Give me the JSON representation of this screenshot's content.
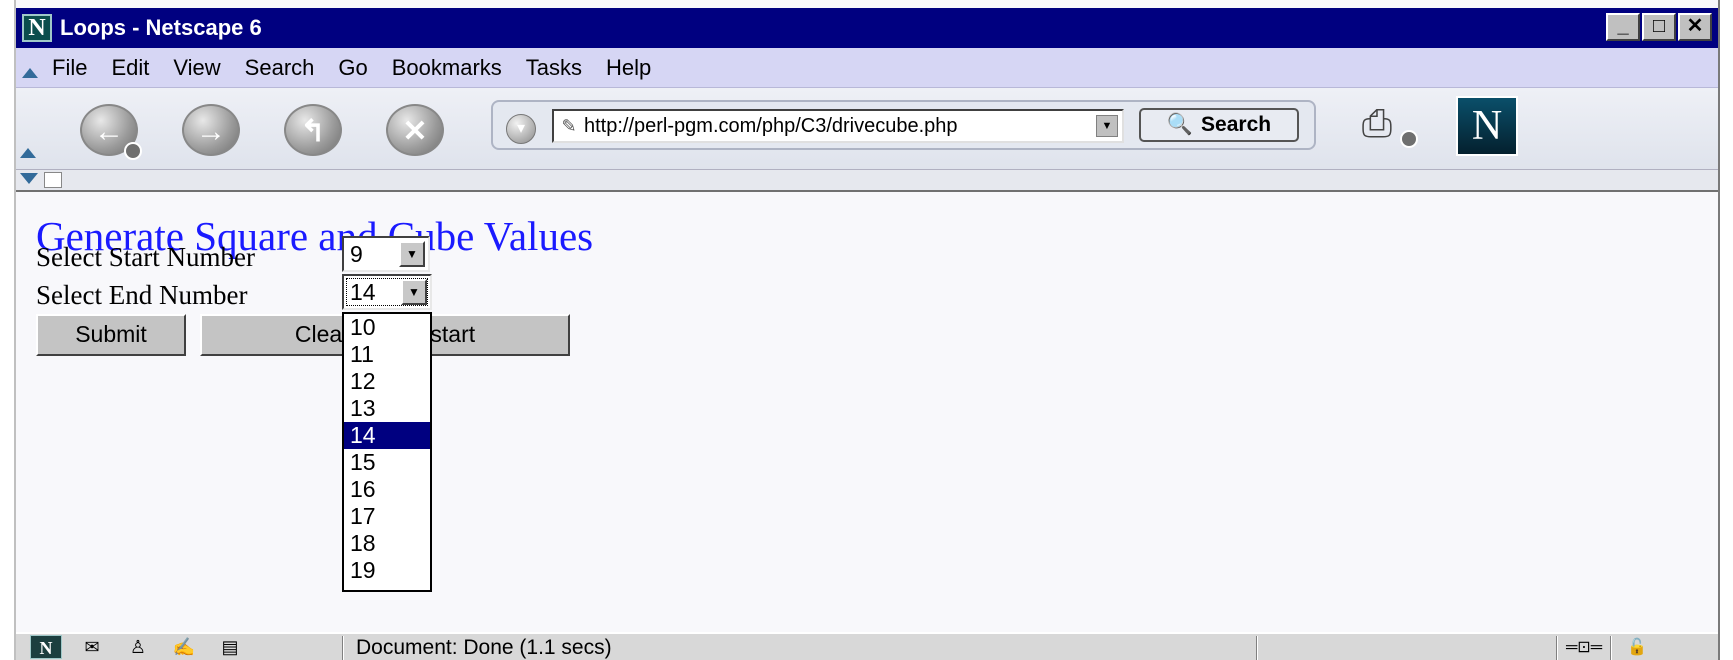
{
  "window": {
    "title": "Loops - Netscape 6",
    "app_logo": "N",
    "controls": [
      "_",
      "□",
      "✕"
    ]
  },
  "menu": [
    "File",
    "Edit",
    "View",
    "Search",
    "Go",
    "Bookmarks",
    "Tasks",
    "Help"
  ],
  "toolbar": {
    "url": "http://perl-pgm.com/php/C3/drivecube.php",
    "search_label": "Search",
    "throbber_logo": "N",
    "icons": [
      "back-icon",
      "forward-icon",
      "reload-icon",
      "stop-icon",
      "go-icon",
      "print-icon"
    ]
  },
  "page": {
    "heading": "Generate Square and Cube Values",
    "start_label": "Select Start Number",
    "start_value": "9",
    "end_label": "Select End Number",
    "end_value": "14",
    "submit_label": "Submit",
    "clear_label": "Clear and Restart",
    "end_options": [
      "10",
      "11",
      "12",
      "13",
      "14",
      "15",
      "16",
      "17",
      "18",
      "19"
    ],
    "selected_option": "14"
  },
  "status": {
    "text": "Document: Done (1.1 secs)",
    "logo": "N"
  }
}
